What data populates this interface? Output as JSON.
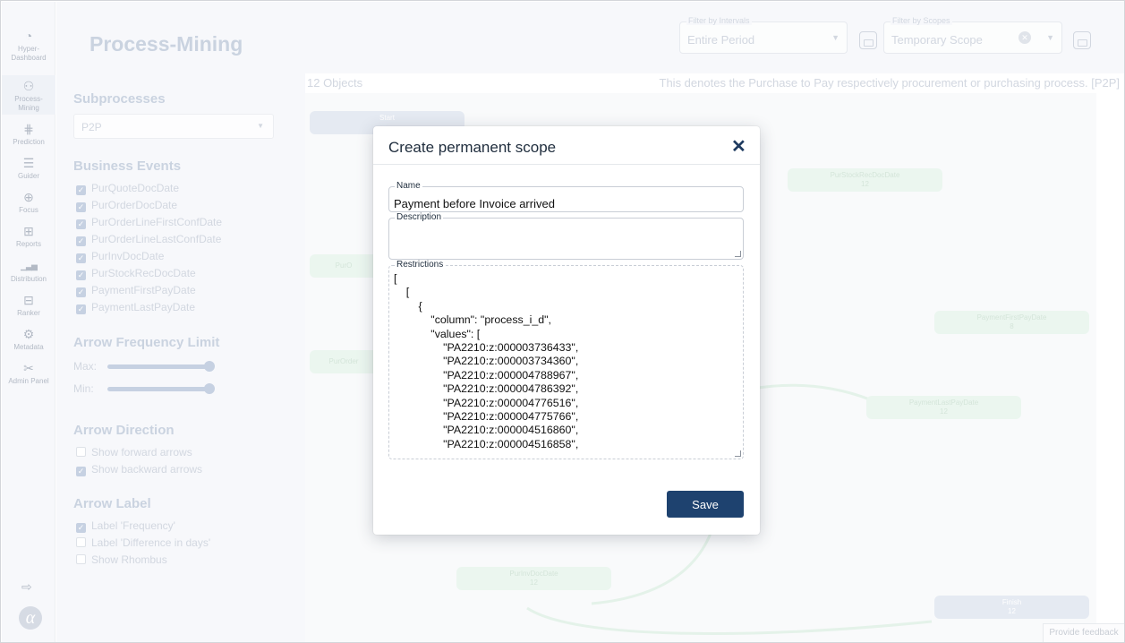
{
  "nav": {
    "items": [
      {
        "icon": "gauge-icon",
        "glyph": "◔",
        "label": "Hyper-\nDashboard"
      },
      {
        "icon": "process-mining-icon",
        "glyph": "⚇",
        "label": "Process-\nMining"
      },
      {
        "icon": "prediction-icon",
        "glyph": "⋕",
        "label": "Prediction"
      },
      {
        "icon": "guider-icon",
        "glyph": "☰",
        "label": "Guider"
      },
      {
        "icon": "focus-icon",
        "glyph": "⊕",
        "label": "Focus"
      },
      {
        "icon": "reports-icon",
        "glyph": "⊞",
        "label": "Reports"
      },
      {
        "icon": "distribution-icon",
        "glyph": "▁▃▅",
        "label": "Distribution"
      },
      {
        "icon": "ranker-icon",
        "glyph": "⊟",
        "label": "Ranker"
      },
      {
        "icon": "metadata-icon",
        "glyph": "⚙",
        "label": "Metadata"
      },
      {
        "icon": "admin-panel-icon",
        "glyph": "✂",
        "label": "Admin Panel"
      }
    ],
    "logout_glyph": "⇨",
    "logo_glyph": "α"
  },
  "header": {
    "title": "Process-Mining",
    "interval_filter": {
      "label": "Filter by Intervals",
      "value": "Entire Period"
    },
    "scope_filter": {
      "label": "Filter by Scopes",
      "value": "Temporary Scope",
      "clear_glyph": "✕"
    },
    "caret_glyph": "▼"
  },
  "panel": {
    "subprocesses_title": "Subprocesses",
    "subprocess_value": "P2P",
    "business_events_title": "Business Events",
    "business_events": [
      {
        "label": "PurQuoteDocDate",
        "checked": true
      },
      {
        "label": "PurOrderDocDate",
        "checked": true
      },
      {
        "label": "PurOrderLineFirstConfDate",
        "checked": true
      },
      {
        "label": "PurOrderLineLastConfDate",
        "checked": true
      },
      {
        "label": "PurInvDocDate",
        "checked": true
      },
      {
        "label": "PurStockRecDocDate",
        "checked": true
      },
      {
        "label": "PaymentFirstPayDate",
        "checked": true
      },
      {
        "label": "PaymentLastPayDate",
        "checked": true
      }
    ],
    "arrow_frequency_title": "Arrow Frequency Limit",
    "max_label": "Max:",
    "min_label": "Min:",
    "max_level_pct": 100,
    "min_level_pct": 100,
    "arrow_direction_title": "Arrow Direction",
    "arrow_direction": [
      {
        "label": "Show forward arrows",
        "checked": false
      },
      {
        "label": "Show backward arrows",
        "checked": true
      }
    ],
    "arrow_label_title": "Arrow Label",
    "arrow_label": [
      {
        "label": "Label 'Frequency'",
        "checked": true
      },
      {
        "label": "Label 'Difference in days'",
        "checked": false
      },
      {
        "label": "Show Rhombus",
        "checked": false
      }
    ],
    "check_glyph": "✓"
  },
  "canvas": {
    "object_count": "12 Objects",
    "description": "This denotes the Purchase to Pay respectively procurement or purchasing process. [P2P]",
    "nodes": [
      {
        "name": "start-node",
        "label": "Start",
        "count": "",
        "color": "blue"
      },
      {
        "name": "node-pur-stock-rec-doc-date",
        "label": "PurStockRecDocDate",
        "count": "12",
        "color": "green"
      },
      {
        "name": "node-pur-order-left",
        "label": "PurO",
        "count": "",
        "color": "green"
      },
      {
        "name": "node-pur-order-doc-left",
        "label": "PurOrder",
        "count": "",
        "color": "green"
      },
      {
        "name": "node-payment-first-pay-date",
        "label": "PaymentFirstPayDate",
        "count": "8",
        "color": "green"
      },
      {
        "name": "node-payment-last-pay-date",
        "label": "PaymentLastPayDate",
        "count": "12",
        "color": "green"
      },
      {
        "name": "node-pur-inv-doc-date",
        "label": "PurInvDocDate",
        "count": "12",
        "color": "green"
      },
      {
        "name": "finish-node",
        "label": "Finish",
        "count": "12",
        "color": "blue"
      }
    ],
    "feedback_label": "Provide feedback"
  },
  "modal": {
    "title": "Create permanent scope",
    "close_glyph": "✕",
    "name_label": "Name",
    "name_value": "Payment before Invoice arrived",
    "description_label": "Description",
    "description_value": "",
    "restrictions_label": "Restrictions",
    "restrictions_text": "[\n    [\n        {\n            \"column\": \"process_i_d\",\n            \"values\": [\n                \"PA2210:z:000003736433\",\n                \"PA2210:z:000003734360\",\n                \"PA2210:z:000004788967\",\n                \"PA2210:z:000004786392\",\n                \"PA2210:z:000004776516\",\n                \"PA2210:z:000004775766\",\n                \"PA2210:z:000004516860\",\n                \"PA2210:z:000004516858\",",
    "save_label": "Save"
  },
  "colors": {
    "accent": "#1e426f",
    "disabled_text": "#c3cad6",
    "node_green": "#e4f3ea",
    "node_blue": "#dde3ee"
  }
}
